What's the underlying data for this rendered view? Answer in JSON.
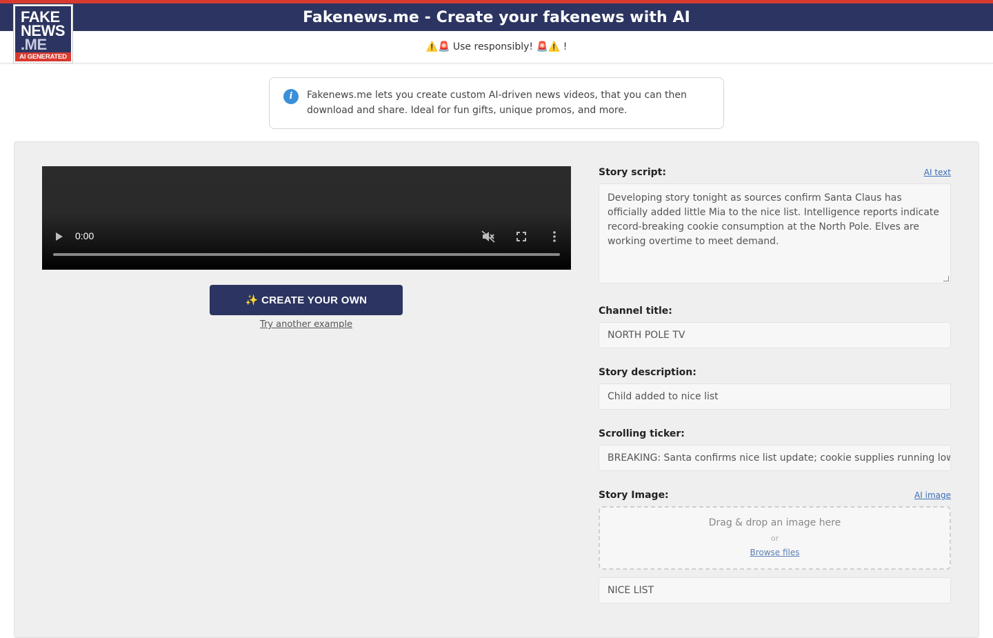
{
  "colors": {
    "brand_navy": "#2c3561",
    "brand_red": "#d83a30",
    "info_blue": "#3a8fd9",
    "link_blue": "#3a6fb8"
  },
  "logo": {
    "line1": "FAKE",
    "line2": "NEWS",
    "line3": ".ME",
    "badge": "AI GENERATED"
  },
  "header": {
    "title": "Fakenews.me - Create your fakenews with AI",
    "warning": "⚠️🚨 Use responsibly! 🚨⚠️ !"
  },
  "info": {
    "icon": "info-icon",
    "text": "Fakenews.me lets you create custom AI-driven news videos, that you can then download and share. Ideal for fun gifts, unique promos, and more."
  },
  "video": {
    "time": "0:00",
    "controls": [
      "play-icon",
      "mute-icon",
      "fullscreen-icon",
      "more-options-icon"
    ]
  },
  "actions": {
    "create_label": "✨ CREATE YOUR OWN",
    "try_another": "Try another example"
  },
  "form": {
    "story_script": {
      "label": "Story script:",
      "ai_link": "AI text",
      "value": "Developing story tonight as sources confirm Santa Claus has officially added little Mia to the nice list. Intelligence reports indicate record-breaking cookie consumption at the North Pole. Elves are working overtime to meet demand."
    },
    "channel_title": {
      "label": "Channel title:",
      "value": "NORTH POLE TV"
    },
    "story_description": {
      "label": "Story description:",
      "value": "Child added to nice list"
    },
    "scrolling_ticker": {
      "label": "Scrolling ticker:",
      "value": "BREAKING: Santa confirms nice list update; cookie supplies running low;"
    },
    "story_image": {
      "label": "Story Image:",
      "ai_link": "AI image",
      "drop_text": "Drag & drop an image here",
      "or_text": "or",
      "browse_label": "Browse files",
      "caption_value": "NICE LIST"
    }
  }
}
